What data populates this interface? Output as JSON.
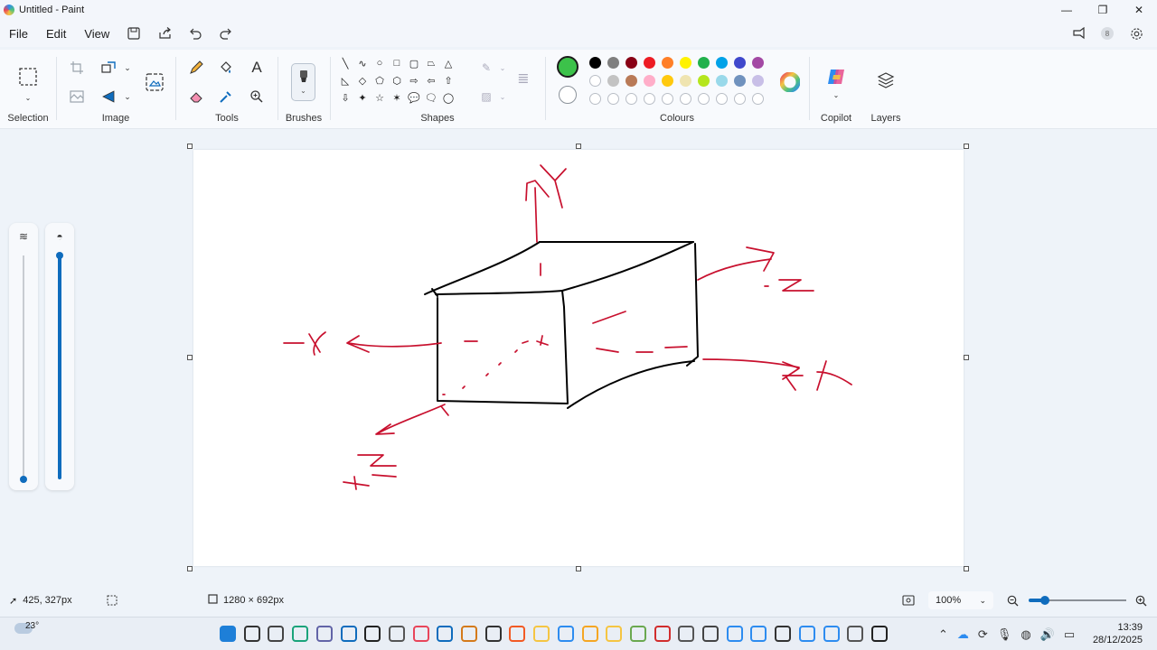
{
  "window": {
    "title": "Untitled - Paint",
    "minimize": "—",
    "maximize": "❐",
    "close": "✕"
  },
  "menu": {
    "file": "File",
    "edit": "Edit",
    "view": "View"
  },
  "ribbon": {
    "groups": {
      "selection": "Selection",
      "image": "Image",
      "tools": "Tools",
      "brushes": "Brushes",
      "shapes": "Shapes",
      "colours": "Colours",
      "copilot": "Copilot",
      "layers": "Layers"
    },
    "primary_color": "#3cc24a",
    "secondary_color": "#ffffff",
    "palette_row1": [
      "#000000",
      "#7f7f7f",
      "#880015",
      "#ed1c24",
      "#ff7f27",
      "#fff200",
      "#22b14c",
      "#00a2e8",
      "#3f48cc",
      "#a349a4"
    ],
    "palette_row2": [
      "#ffffff",
      "#c3c3c3",
      "#b97a57",
      "#ffaec9",
      "#ffc90e",
      "#efe4b0",
      "#b5e61d",
      "#99d9ea",
      "#7092be",
      "#c8bfe7"
    ],
    "palette_row3_empty": 10,
    "shapes_icons": [
      "╲",
      "∿",
      "○",
      "□",
      "▢",
      "⏢",
      "△",
      "◺",
      "◇",
      "⬠",
      "⬡",
      "⇨",
      "⇦",
      "⇧",
      "⇩",
      "✦",
      "☆",
      "✶",
      "💬",
      "🗨",
      "◯"
    ]
  },
  "drawing": {
    "ink_black": "#000000",
    "ink_red": "#c8102e"
  },
  "status": {
    "cursor": "425, 327px",
    "size": "1280 × 692px",
    "zoom": "100%",
    "zoom_level_fraction": 0.12
  },
  "side": {
    "size_level": 1.0,
    "opacity_level": 1.0
  },
  "taskbar": {
    "weather": "23°",
    "time": "13:39",
    "date": "28/12/2025"
  }
}
